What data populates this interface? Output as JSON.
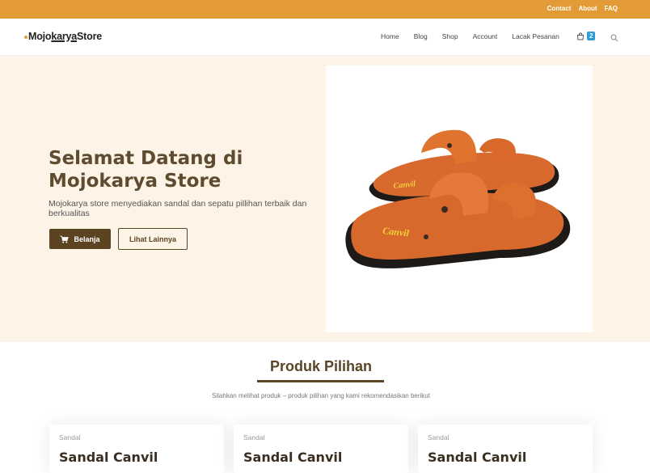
{
  "topbar": {
    "links": [
      "Contact",
      "About",
      "FAQ"
    ]
  },
  "header": {
    "logo_pre": "Mojo",
    "logo_underline": "karya",
    "logo_post": "Store",
    "nav": [
      "Home",
      "Blog",
      "Shop",
      "Account",
      "Lacak Pesanan"
    ],
    "cart_count": "2"
  },
  "hero": {
    "title": "Selamat Datang di Mojokarya Store",
    "subtitle": "Mojokarya store menyediakan sandal dan sepatu pillihan terbaik dan berkualitas",
    "shop_label": "Belanja",
    "more_label": "Lihat Lainnya",
    "sandal_brand": "Canvil"
  },
  "featured": {
    "title": "Produk Pilihan",
    "subtitle": "Silahkan melihat produk – produk pilihan yang kami rekomendasikan berikut",
    "products": [
      {
        "category": "Sandal",
        "name": "Sandal Canvil"
      },
      {
        "category": "Sandal",
        "name": "Sandal Canvil"
      },
      {
        "category": "Sandal",
        "name": "Sandal Canvil"
      }
    ]
  },
  "colors": {
    "topbar": "#e29b36",
    "hero_bg": "#fdf3e6",
    "brand_brown": "#5c4423",
    "badge": "#2e9ad8"
  }
}
